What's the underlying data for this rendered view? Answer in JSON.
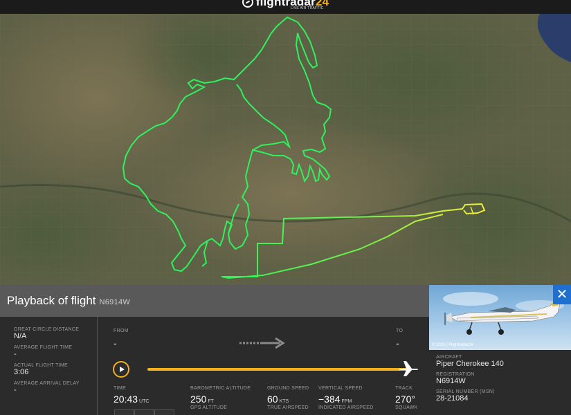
{
  "app": {
    "brand_main": "flightradar",
    "brand_num": "24",
    "brand_sub": "LIVE AIR TRAFFIC"
  },
  "colors": {
    "accent": "#f6b21b",
    "track_green": "#2ef25d",
    "track_yellow": "#e8ee3a",
    "close_blue": "#1f6fd1"
  },
  "panel": {
    "title": "Playback of flight",
    "flight": "N6914W"
  },
  "stats": {
    "gcd_label": "GREAT CIRCLE DISTANCE",
    "gcd_value": "N/A",
    "avg_time_label": "AVERAGE FLIGHT TIME",
    "avg_time_value": "-",
    "actual_time_label": "ACTUAL FLIGHT TIME",
    "actual_time_value": "3:06",
    "avg_delay_label": "AVERAGE ARRIVAL DELAY",
    "avg_delay_value": "-"
  },
  "route": {
    "from_label": "FROM",
    "from_value": "-",
    "to_label": "TO",
    "to_value": "-"
  },
  "playback": {
    "progress": 1.0
  },
  "telemetry": {
    "time_label": "TIME",
    "time_value": "20:43",
    "time_unit": "UTC",
    "baro_label": "BAROMETRIC ALTITUDE",
    "baro_value": "250",
    "baro_unit": "FT",
    "gps_label": "GPS ALTITUDE",
    "gs_label": "GROUND SPEED",
    "gs_value": "60",
    "gs_unit": "KTS",
    "tas_label": "TRUE AIRSPEED",
    "vs_label": "VERTICAL SPEED",
    "vs_value": "−384",
    "vs_unit": "FPM",
    "ias_label": "INDICATED AIRSPEED",
    "track_label": "TRACK",
    "track_value": "270°",
    "squawk_label": "SQUAWK"
  },
  "aircraft": {
    "photo_credit": "© 2025 | Flightradar24",
    "aircraft_label": "AIRCRAFT",
    "aircraft_value": "Piper Cherokee 140",
    "reg_label": "REGISTRATION",
    "reg_value": "N6914W",
    "serial_label": "SERIAL NUMBER (MSN)",
    "serial_value": "28-21084"
  }
}
